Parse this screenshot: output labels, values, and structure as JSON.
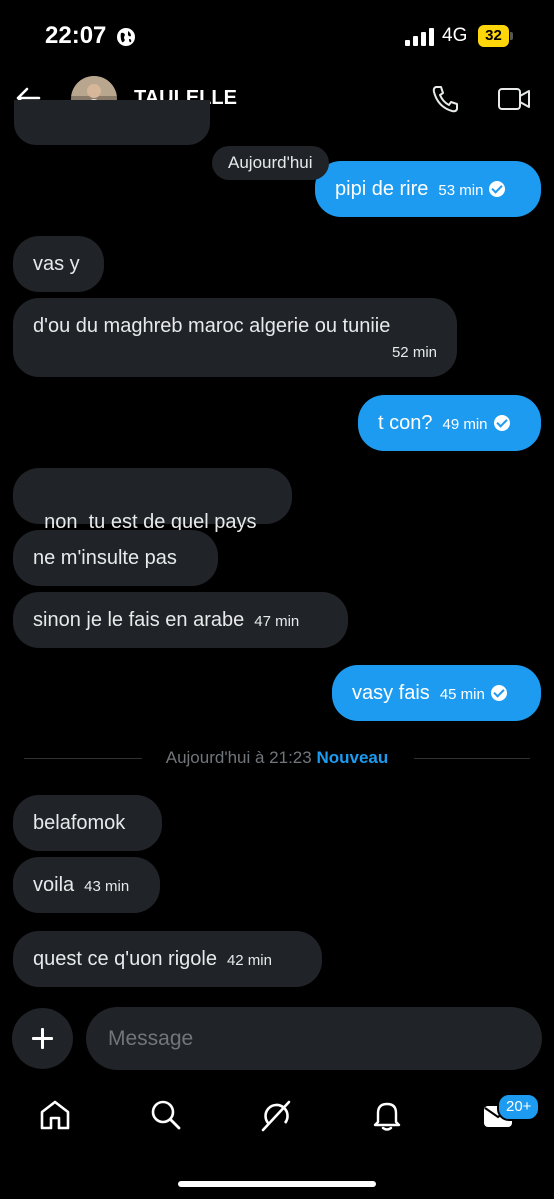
{
  "status": {
    "time": "22:07",
    "network": "4G",
    "battery": "32"
  },
  "header": {
    "contact_name": "TAULELLE"
  },
  "conversation": {
    "date_pill": "Aujourd'hui",
    "messages": [
      {
        "text": "pipi de rire",
        "time": "53 min",
        "dir": "out"
      },
      {
        "text": "vas y",
        "time": "",
        "dir": "in"
      },
      {
        "text": "d'ou du maghreb maroc algerie ou tuniie",
        "time": "52 min",
        "dir": "in"
      },
      {
        "text": "t con?",
        "time": "49 min",
        "dir": "out"
      },
      {
        "text": "non  tu est de quel pays",
        "time": "",
        "dir": "in"
      },
      {
        "text": "ne m'insulte pas",
        "time": "",
        "dir": "in"
      },
      {
        "text": "sinon je le fais en arabe",
        "time": "47 min",
        "dir": "in"
      },
      {
        "text": "vasy fais",
        "time": "45 min",
        "dir": "out"
      },
      {
        "text": "belafomok",
        "time": "",
        "dir": "in"
      },
      {
        "text": "voila",
        "time": "43 min",
        "dir": "in"
      },
      {
        "text": "quest ce q'uon rigole",
        "time": "42 min",
        "dir": "in"
      }
    ],
    "divider": {
      "text": "Aujourd'hui à 21:23",
      "new_label": "Nouveau"
    }
  },
  "composer": {
    "placeholder": "Message"
  },
  "nav": {
    "badge": "20+",
    "items": [
      "home-icon",
      "search-icon",
      "grok-icon",
      "notifications-icon",
      "messages-icon"
    ]
  },
  "colors": {
    "accent": "#1d9bf0",
    "incoming_bubble": "#202327",
    "background": "#000000"
  }
}
